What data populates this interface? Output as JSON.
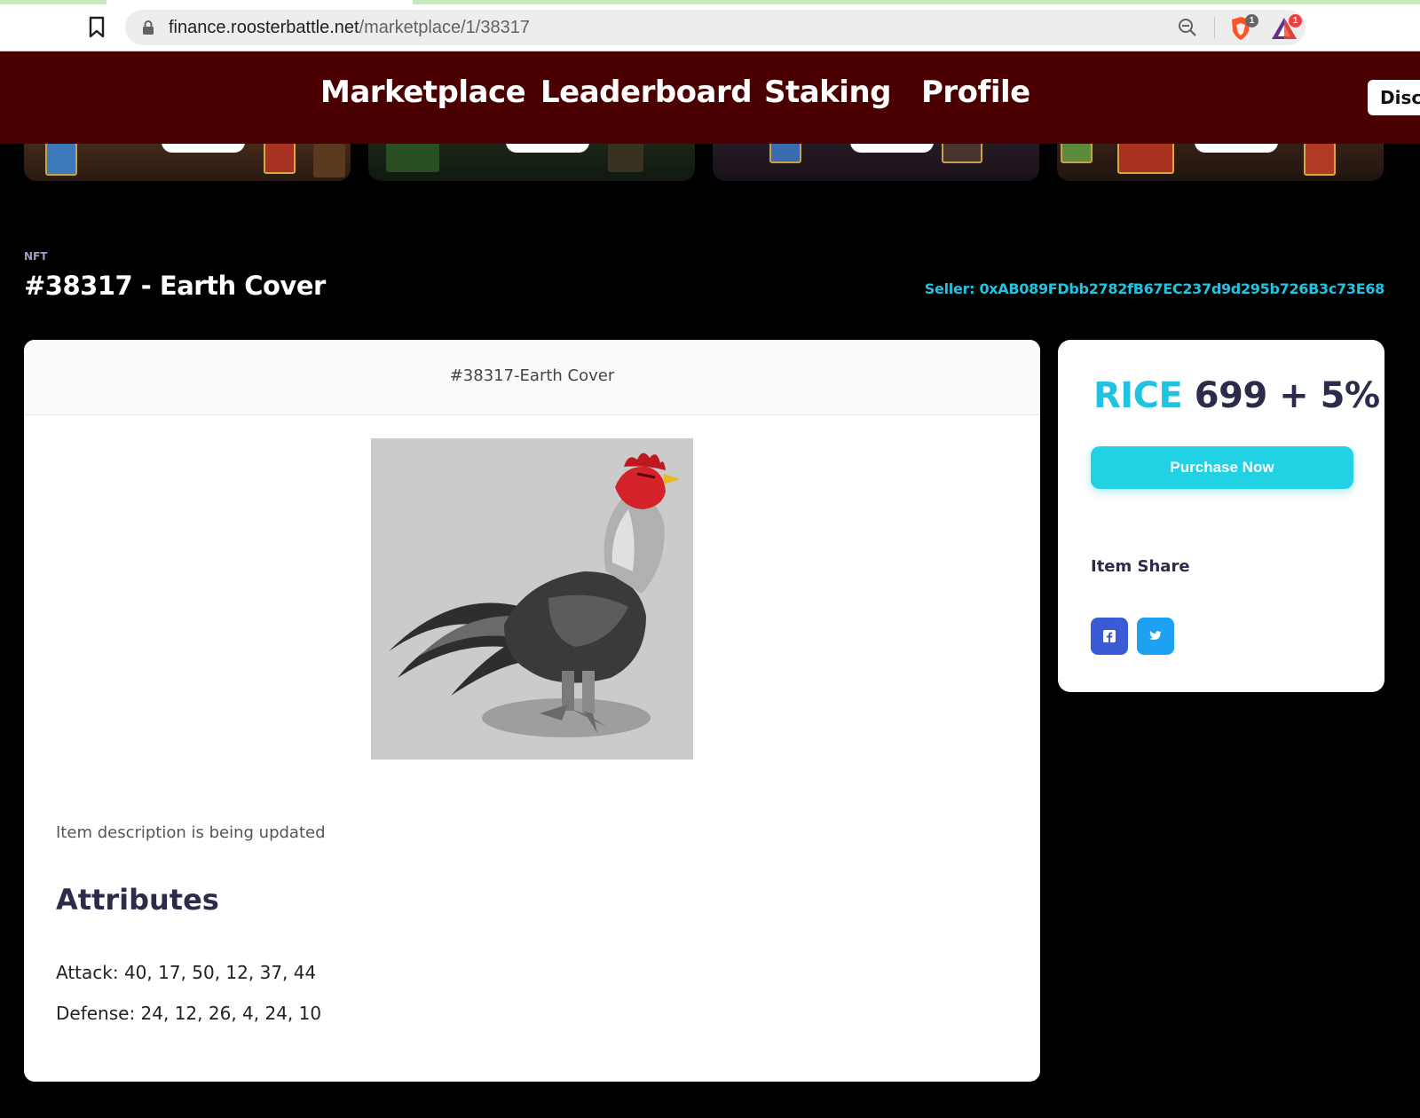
{
  "browser": {
    "url_host": "finance.roosterbattle.net",
    "url_path": "/marketplace/1/38317",
    "shield_badge": "1",
    "rewards_badge": "1"
  },
  "nav": {
    "marketplace": "Marketplace",
    "leaderboard": "Leaderboard",
    "staking": "Staking",
    "profile": "Profile",
    "discord": "Disc"
  },
  "item": {
    "label": "NFT",
    "title": "#38317 - Earth Cover",
    "seller": "Seller: 0xAB089FDbb2782fB67EC237d9d295b726B3c73E68",
    "card_title": "#38317-Earth Cover",
    "description": "Item description is being updated",
    "attributes_heading": "Attributes",
    "attack": "Attack: 40, 17, 50, 12, 37, 44",
    "defense": "Defense: 24, 12, 26, 4, 24, 10"
  },
  "purchase": {
    "currency": "RICE",
    "amount": " 699 + 5%",
    "button_label": "Purchase Now",
    "share_label": "Item Share"
  },
  "colors": {
    "nav_bg": "#4a0000",
    "accent": "#22c3e0",
    "heading": "#2a2d4a",
    "facebook": "#3b5bd5",
    "twitter": "#1da1f2"
  },
  "icons": {
    "bookmark": "bookmark-icon",
    "lock": "lock-icon",
    "zoom": "zoom-out-icon",
    "shield": "brave-shield-icon",
    "rewards": "brave-rewards-icon",
    "facebook": "facebook-icon",
    "twitter": "twitter-icon"
  }
}
